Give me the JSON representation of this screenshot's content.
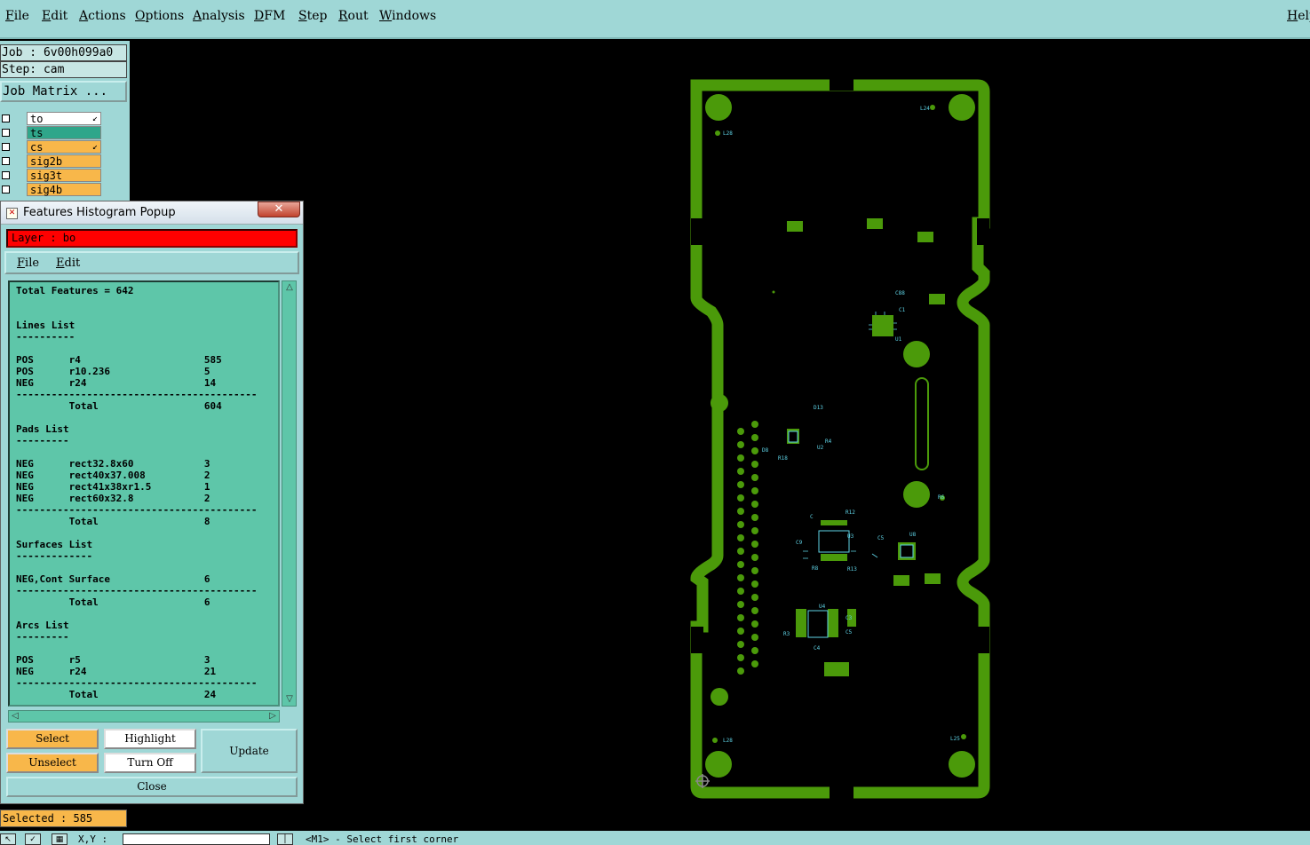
{
  "menu": {
    "items": [
      "File",
      "Edit",
      "Actions",
      "Options",
      "Analysis",
      "DFM",
      "Step",
      "Rout",
      "Windows"
    ],
    "help": "Help"
  },
  "info": {
    "job": "Job : 6v00h099a0",
    "step": "Step: cam",
    "job_matrix": "Job Matrix ..."
  },
  "layers": [
    {
      "name": "to",
      "color": "#ffffff",
      "mark": true
    },
    {
      "name": "ts",
      "color": "#2fa68a",
      "mark": false
    },
    {
      "name": "cs",
      "color": "#f8b74a",
      "mark": true
    },
    {
      "name": "sig2b",
      "color": "#f8b74a",
      "mark": false
    },
    {
      "name": "sig3t",
      "color": "#f8b74a",
      "mark": false
    },
    {
      "name": "sig4b",
      "color": "#f8b74a",
      "mark": false
    }
  ],
  "popup": {
    "title": "Features Histogram Popup",
    "close_glyph": "✕",
    "layer_label": "Layer :  bo",
    "menu": {
      "file": "File",
      "edit": "Edit"
    },
    "report": {
      "total": "Total Features = 642",
      "lines_header": "Lines List",
      "lines": [
        {
          "pol": "POS",
          "sym": "r4",
          "count": "585"
        },
        {
          "pol": "POS",
          "sym": "r10.236",
          "count": "5"
        },
        {
          "pol": "NEG",
          "sym": "r24",
          "count": "14"
        }
      ],
      "lines_total": "604",
      "pads_header": "Pads List",
      "pads": [
        {
          "pol": "NEG",
          "sym": "rect32.8x60",
          "count": "3"
        },
        {
          "pol": "NEG",
          "sym": "rect40x37.008",
          "count": "2"
        },
        {
          "pol": "NEG",
          "sym": "rect41x38xr1.5",
          "count": "1"
        },
        {
          "pol": "NEG",
          "sym": "rect60x32.8",
          "count": "2"
        }
      ],
      "pads_total": "8",
      "surfaces_header": "Surfaces List",
      "surfaces": [
        {
          "pol": "NEG,Cont",
          "sym": "Surface",
          "count": "6"
        }
      ],
      "surfaces_total": "6",
      "arcs_header": "Arcs List",
      "arcs": [
        {
          "pol": "POS",
          "sym": "r5",
          "count": "3"
        },
        {
          "pol": "NEG",
          "sym": "r24",
          "count": "21"
        }
      ],
      "arcs_total": "24",
      "total_label": "Total"
    },
    "buttons": {
      "select": "Select",
      "highlight": "Highlight",
      "update": "Update",
      "unselect": "Unselect",
      "turn_off": "Turn Off",
      "close": "Close"
    }
  },
  "status": {
    "selected": "Selected : 585",
    "xy_label": "X,Y :",
    "message": "<M1> - Select first corner"
  },
  "colors": {
    "board": "#4b9a0a",
    "silk": "#5fd3e6",
    "background": "#000000",
    "panel": "#9fd7d6"
  }
}
